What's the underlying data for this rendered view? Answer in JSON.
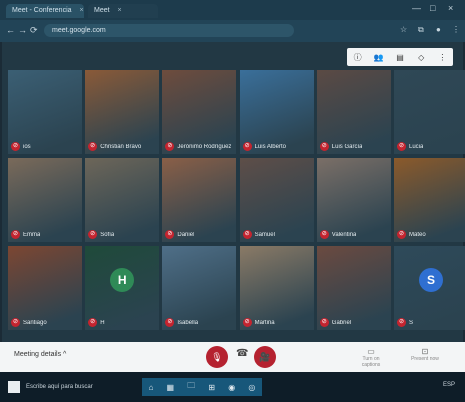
{
  "browser": {
    "tabs": [
      {
        "label": "Meet - Conferencia",
        "close": "×"
      },
      {
        "label": "Meet",
        "close": "×"
      }
    ],
    "url": "meet.google.com",
    "window_controls": [
      "—",
      "□",
      "×"
    ],
    "nav": [
      "←",
      "→",
      "⟳"
    ]
  },
  "meeting": {
    "toolbar_icons": [
      "info-icon",
      "people-icon",
      "chat-icon",
      "activities-icon",
      "more-icon"
    ],
    "participants": [
      {
        "name": "ios",
        "initial": "",
        "color": "#3b5f74"
      },
      {
        "name": "Christian Bravo",
        "initial": "",
        "color": "#8a5a38"
      },
      {
        "name": "Jerónimo Rodríguez",
        "initial": "",
        "color": "#6e4c3d"
      },
      {
        "name": "Luis Alberto",
        "initial": "",
        "color": "#3a6f9a"
      },
      {
        "name": "Luis García",
        "initial": "",
        "color": "#5b4a44"
      },
      {
        "name": "Lucia",
        "initial": "",
        "color": "#2f4856"
      },
      {
        "name": "Emma",
        "initial": "",
        "color": "#7a6a5a"
      },
      {
        "name": "Sofía",
        "initial": "",
        "color": "#6d6659"
      },
      {
        "name": "Daniel",
        "initial": "",
        "color": "#8a5f47"
      },
      {
        "name": "Samuel",
        "initial": "",
        "color": "#5e4e48"
      },
      {
        "name": "Valentina",
        "initial": "",
        "color": "#7b6f67"
      },
      {
        "name": "Mateo",
        "initial": "",
        "color": "#8b5a2b"
      },
      {
        "name": "Santiago",
        "initial": "",
        "color": "#7c4632"
      },
      {
        "name": "H",
        "initial": "H",
        "color": "#1f4a3a"
      },
      {
        "name": "Isabella",
        "initial": "",
        "color": "#4f6f88"
      },
      {
        "name": "Martina",
        "initial": "",
        "color": "#8a7a66"
      },
      {
        "name": "Gabriel",
        "initial": "",
        "color": "#6b4a40"
      },
      {
        "name": "S",
        "initial": "S",
        "color": "#2e4a5a"
      }
    ],
    "initial_bg": {
      "H": "#2f8a57",
      "S": "#2f6fd1"
    }
  },
  "controls": {
    "meeting_code": "Meeting details ^",
    "mic_label": "🎙",
    "hangup_label": "☎",
    "camera_label": "🎥",
    "captions_label": "Turn on captions",
    "present_label": "Present now"
  },
  "taskbar": {
    "search_placeholder": "Escribe aquí para buscar",
    "apps": [
      "⌂",
      "▦",
      "🗀",
      "⊞",
      "◉",
      "◎"
    ],
    "tray": "ESP"
  }
}
